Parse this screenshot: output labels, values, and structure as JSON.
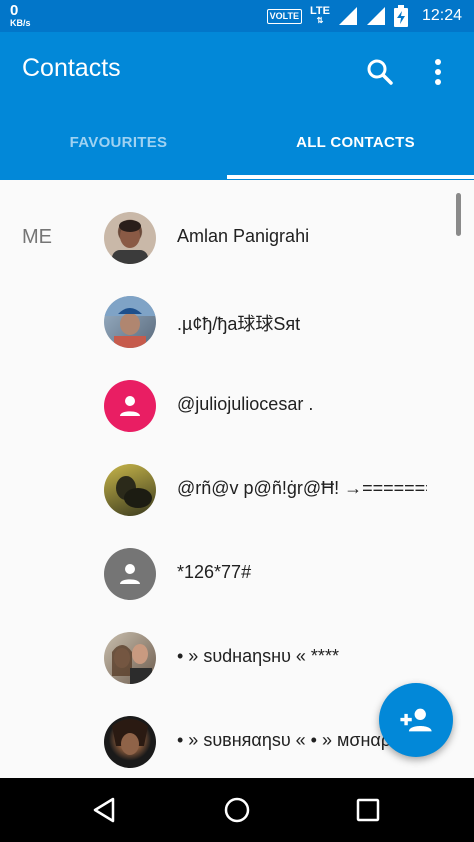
{
  "status_bar": {
    "net_speed": "0",
    "net_unit": "KB/s",
    "volte": "VOLTE",
    "network": "LTE",
    "time": "12:24"
  },
  "app_bar": {
    "title": "Contacts",
    "search_icon": "search-icon",
    "more_icon": "more-vert-icon"
  },
  "tabs": [
    {
      "label": "FAVOURITES",
      "active": false
    },
    {
      "label": "ALL CONTACTS",
      "active": true
    }
  ],
  "section_label": "ME",
  "contacts": [
    {
      "name": "Amlan Panigrahi",
      "avatar": "photo"
    },
    {
      "name": ".µ¢ђ/ђa球球Sяt",
      "avatar": "photo"
    },
    {
      "name": "@juliojuliocesar .",
      "avatar": "person-icon",
      "avatar_color": "#e91e63"
    },
    {
      "name": "@rñ@v p@ñ!ġr@Ħ! →=======..",
      "avatar": "photo"
    },
    {
      "name": "*126*77#",
      "avatar": "person-icon",
      "avatar_color": "#757575"
    },
    {
      "name": "• » ѕυdнaηѕнυ « ****",
      "avatar": "photo"
    },
    {
      "name": "• » ѕυвняαηѕυ « • » мσнαρα",
      "avatar": "photo"
    }
  ],
  "fab_icon": "add-person-icon",
  "nav": [
    "back-icon",
    "home-icon",
    "recents-icon"
  ],
  "colors": {
    "primary": "#0288d8",
    "status_bar": "#0276c9",
    "pink": "#e91e63",
    "grey": "#757575"
  }
}
